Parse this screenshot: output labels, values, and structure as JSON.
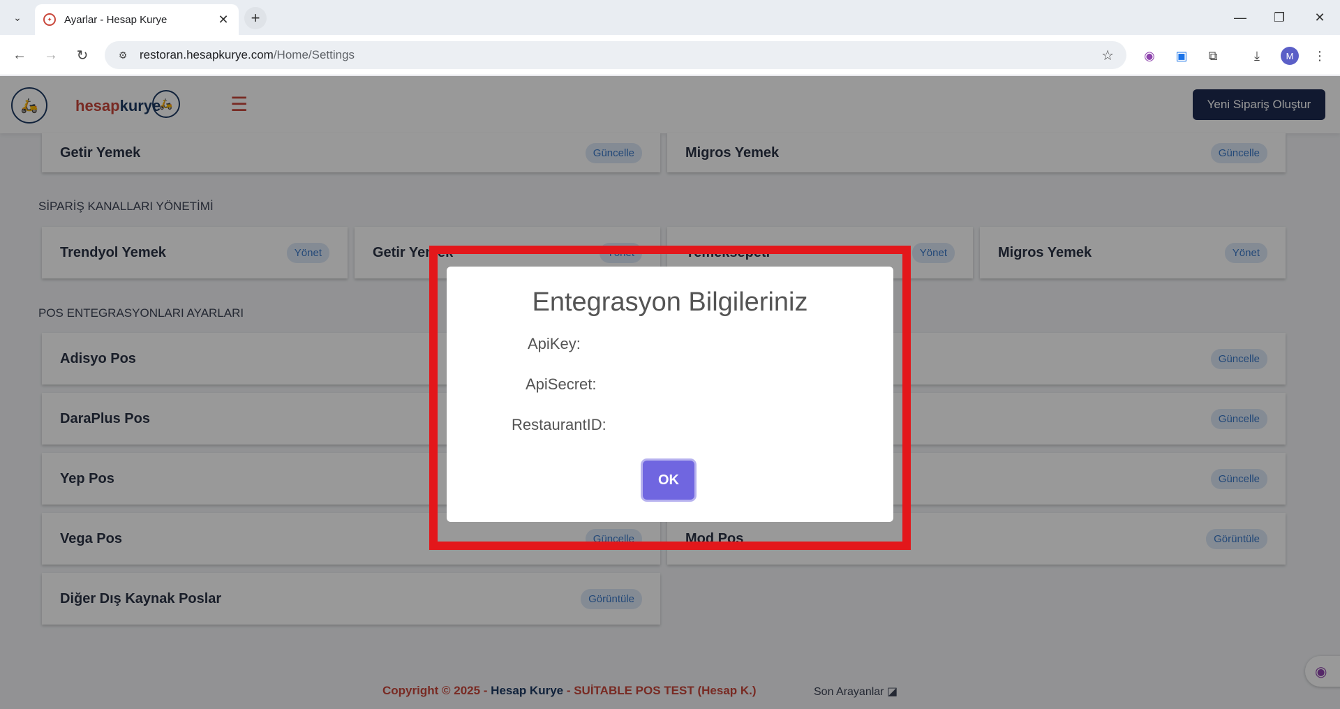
{
  "browser": {
    "tab_title": "Ayarlar - Hesap Kurye",
    "url_host": "restoran.hesapkurye.com",
    "url_path": "/Home/Settings",
    "avatar_initial": "M"
  },
  "header": {
    "brand_part1": "hesap",
    "brand_part2": "kurye",
    "new_order_label": "Yeni Sipariş Oluştur"
  },
  "top_cards": [
    {
      "title": "Getir Yemek",
      "action": "Güncelle"
    },
    {
      "title": "Migros Yemek",
      "action": "Güncelle"
    }
  ],
  "channels": {
    "label": "SİPARİŞ KANALLARI YÖNETİMİ",
    "items": [
      {
        "title": "Trendyol Yemek",
        "action": "Yönet"
      },
      {
        "title": "Getir Yemek",
        "action": "Yönet"
      },
      {
        "title": "Yemeksepeti",
        "action": "Yönet"
      },
      {
        "title": "Migros Yemek",
        "action": "Yönet"
      }
    ]
  },
  "pos": {
    "label": "POS ENTEGRASYONLARI AYARLARI",
    "left": [
      {
        "title": "Adisyo Pos",
        "action": ""
      },
      {
        "title": "DaraPlus Pos",
        "action": ""
      },
      {
        "title": "Yep Pos",
        "action": ""
      },
      {
        "title": "Vega Pos",
        "action": "Güncelle"
      },
      {
        "title": "Diğer Dış Kaynak Poslar",
        "action": "Görüntüle"
      }
    ],
    "right": [
      {
        "title": "",
        "action": "Güncelle"
      },
      {
        "title": "",
        "action": "Güncelle"
      },
      {
        "title": "",
        "action": "Güncelle"
      },
      {
        "title": "Mod Pos",
        "action": "Görüntüle"
      }
    ]
  },
  "footer": {
    "copyright": "Copyright © 2025 - ",
    "company": "Hesap Kurye",
    "suffix": " - SUİTABLE POS TEST (Hesap K.)",
    "recent_callers": "Son Arayanlar"
  },
  "modal": {
    "title": "Entegrasyon Bilgileriniz",
    "api_key_label": "ApiKey:",
    "api_secret_label": "ApiSecret:",
    "restaurant_id_label": "RestaurantID:",
    "ok_label": "OK"
  }
}
